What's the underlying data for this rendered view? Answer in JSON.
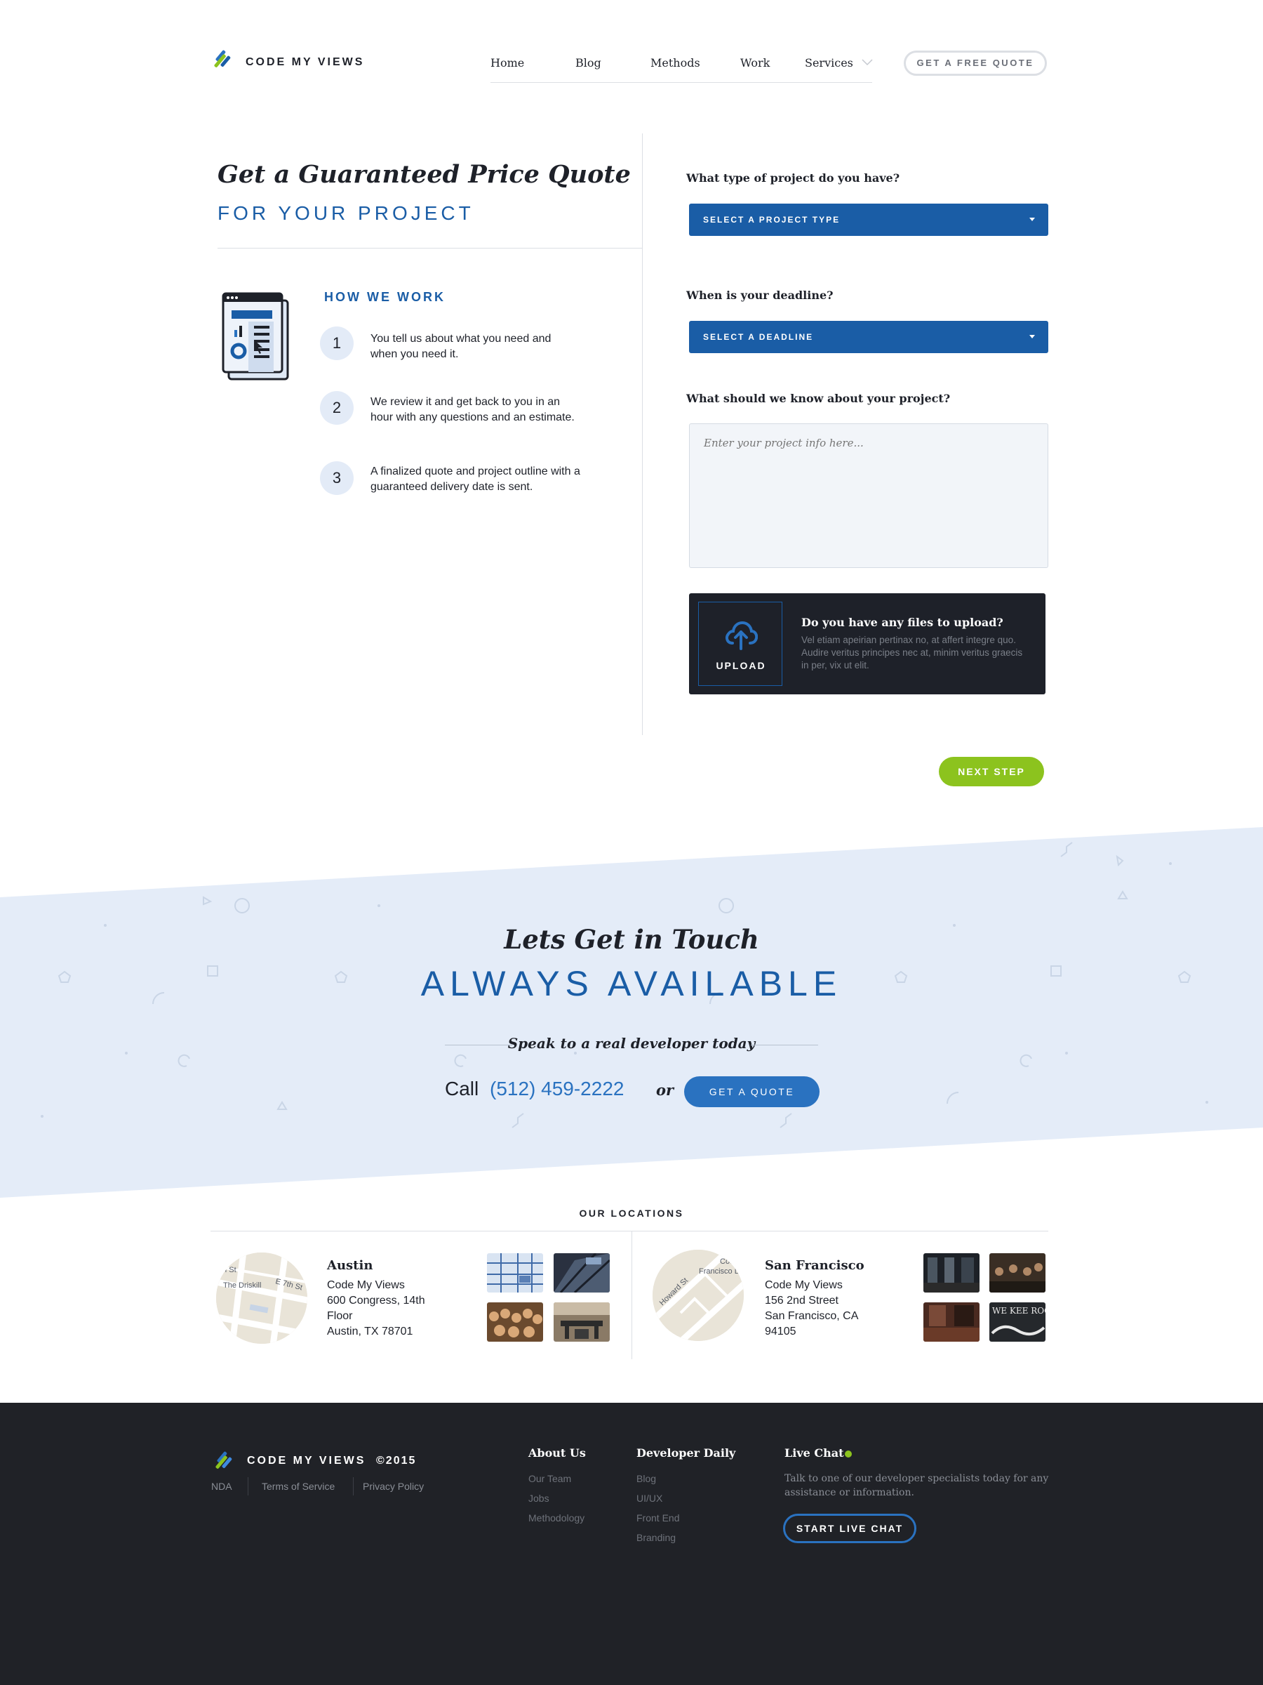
{
  "header": {
    "logo_text": "CODE MY VIEWS",
    "nav": [
      "Home",
      "Blog",
      "Methods",
      "Work",
      "Services"
    ],
    "quote_button": "GET A FREE QUOTE"
  },
  "hero": {
    "title": "Get a Guaranteed Price Quote",
    "subtitle": "FOR YOUR PROJECT"
  },
  "how_we_work": {
    "title": "HOW WE WORK",
    "steps": [
      {
        "num": "1",
        "text": "You tell us about what you need and when you need it."
      },
      {
        "num": "2",
        "text": "We review it and get back to you in an hour with any questions and an estimate."
      },
      {
        "num": "3",
        "text": "A finalized quote and project outline with a guaranteed delivery date is sent."
      }
    ]
  },
  "form": {
    "project_type_label": "What type of project do you have?",
    "project_type_value": "SELECT A PROJECT TYPE",
    "deadline_label": "When is your deadline?",
    "deadline_value": "SELECT A DEADLINE",
    "info_label": "What should we know about your project?",
    "info_placeholder": "Enter your project info here...",
    "upload_button": "UPLOAD",
    "upload_question": "Do you have any files to upload?",
    "upload_description": "Vel etiam apeirian pertinax no, at affert integre quo. Audire veritus principes nec at, minim veritus graecis in per, vix ut elit.",
    "next_button": "NEXT STEP"
  },
  "contact": {
    "title": "Lets Get in Touch",
    "subtitle": "ALWAYS AVAILABLE",
    "tagline": "Speak to a real developer today",
    "call_word": "Call",
    "phone": "(512) 459-2222",
    "or_word": "or",
    "quote_button": "GET A QUOTE"
  },
  "locations": {
    "heading": "OUR LOCATIONS",
    "austin": {
      "city": "Austin",
      "lines": [
        "Code My Views",
        "600 Congress, 14th",
        "Floor",
        "Austin, TX 78701"
      ],
      "map_labels": [
        "th St",
        "The Driskill",
        "E 7th St"
      ]
    },
    "sf": {
      "city": "San Francisco",
      "lines": [
        "Code My Views",
        "156 2nd Street",
        "San Francisco, CA",
        "94105"
      ],
      "map_labels": [
        "Howard St",
        "Cou",
        "Francisco D"
      ]
    },
    "thumb_sign_text": "WE KEE ROCKIN"
  },
  "footer": {
    "logo_text": "CODE MY VIEWS",
    "copyright": "©2015",
    "legal_links": [
      "NDA",
      "Terms of Service",
      "Privacy Policy"
    ],
    "about_title": "About Us",
    "about_links": [
      "Our Team",
      "Jobs",
      "Methodology"
    ],
    "daily_title": "Developer Daily",
    "daily_links": [
      "Blog",
      "UI/UX",
      "Front End",
      "Branding"
    ],
    "chat_title": "Live Chat",
    "chat_description": "Talk to one of our developer specialists today for any assistance or information.",
    "chat_button": "START LIVE CHAT"
  },
  "colors": {
    "brand_blue": "#1a5da6",
    "accent_blue": "#2a72c0",
    "green": "#8cc31e",
    "dark": "#1e2129",
    "band_bg": "#e4ecf8"
  }
}
